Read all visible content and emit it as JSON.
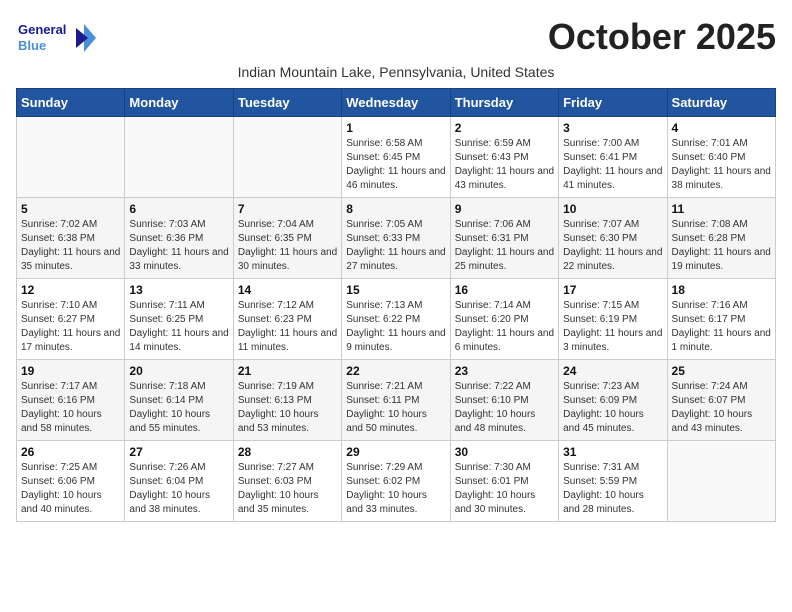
{
  "header": {
    "logo_line1": "General",
    "logo_line2": "Blue",
    "month": "October 2025",
    "subtitle": "Indian Mountain Lake, Pennsylvania, United States"
  },
  "days_of_week": [
    "Sunday",
    "Monday",
    "Tuesday",
    "Wednesday",
    "Thursday",
    "Friday",
    "Saturday"
  ],
  "weeks": [
    [
      {
        "day": "",
        "info": ""
      },
      {
        "day": "",
        "info": ""
      },
      {
        "day": "",
        "info": ""
      },
      {
        "day": "1",
        "info": "Sunrise: 6:58 AM\nSunset: 6:45 PM\nDaylight: 11 hours and 46 minutes."
      },
      {
        "day": "2",
        "info": "Sunrise: 6:59 AM\nSunset: 6:43 PM\nDaylight: 11 hours and 43 minutes."
      },
      {
        "day": "3",
        "info": "Sunrise: 7:00 AM\nSunset: 6:41 PM\nDaylight: 11 hours and 41 minutes."
      },
      {
        "day": "4",
        "info": "Sunrise: 7:01 AM\nSunset: 6:40 PM\nDaylight: 11 hours and 38 minutes."
      }
    ],
    [
      {
        "day": "5",
        "info": "Sunrise: 7:02 AM\nSunset: 6:38 PM\nDaylight: 11 hours and 35 minutes."
      },
      {
        "day": "6",
        "info": "Sunrise: 7:03 AM\nSunset: 6:36 PM\nDaylight: 11 hours and 33 minutes."
      },
      {
        "day": "7",
        "info": "Sunrise: 7:04 AM\nSunset: 6:35 PM\nDaylight: 11 hours and 30 minutes."
      },
      {
        "day": "8",
        "info": "Sunrise: 7:05 AM\nSunset: 6:33 PM\nDaylight: 11 hours and 27 minutes."
      },
      {
        "day": "9",
        "info": "Sunrise: 7:06 AM\nSunset: 6:31 PM\nDaylight: 11 hours and 25 minutes."
      },
      {
        "day": "10",
        "info": "Sunrise: 7:07 AM\nSunset: 6:30 PM\nDaylight: 11 hours and 22 minutes."
      },
      {
        "day": "11",
        "info": "Sunrise: 7:08 AM\nSunset: 6:28 PM\nDaylight: 11 hours and 19 minutes."
      }
    ],
    [
      {
        "day": "12",
        "info": "Sunrise: 7:10 AM\nSunset: 6:27 PM\nDaylight: 11 hours and 17 minutes."
      },
      {
        "day": "13",
        "info": "Sunrise: 7:11 AM\nSunset: 6:25 PM\nDaylight: 11 hours and 14 minutes."
      },
      {
        "day": "14",
        "info": "Sunrise: 7:12 AM\nSunset: 6:23 PM\nDaylight: 11 hours and 11 minutes."
      },
      {
        "day": "15",
        "info": "Sunrise: 7:13 AM\nSunset: 6:22 PM\nDaylight: 11 hours and 9 minutes."
      },
      {
        "day": "16",
        "info": "Sunrise: 7:14 AM\nSunset: 6:20 PM\nDaylight: 11 hours and 6 minutes."
      },
      {
        "day": "17",
        "info": "Sunrise: 7:15 AM\nSunset: 6:19 PM\nDaylight: 11 hours and 3 minutes."
      },
      {
        "day": "18",
        "info": "Sunrise: 7:16 AM\nSunset: 6:17 PM\nDaylight: 11 hours and 1 minute."
      }
    ],
    [
      {
        "day": "19",
        "info": "Sunrise: 7:17 AM\nSunset: 6:16 PM\nDaylight: 10 hours and 58 minutes."
      },
      {
        "day": "20",
        "info": "Sunrise: 7:18 AM\nSunset: 6:14 PM\nDaylight: 10 hours and 55 minutes."
      },
      {
        "day": "21",
        "info": "Sunrise: 7:19 AM\nSunset: 6:13 PM\nDaylight: 10 hours and 53 minutes."
      },
      {
        "day": "22",
        "info": "Sunrise: 7:21 AM\nSunset: 6:11 PM\nDaylight: 10 hours and 50 minutes."
      },
      {
        "day": "23",
        "info": "Sunrise: 7:22 AM\nSunset: 6:10 PM\nDaylight: 10 hours and 48 minutes."
      },
      {
        "day": "24",
        "info": "Sunrise: 7:23 AM\nSunset: 6:09 PM\nDaylight: 10 hours and 45 minutes."
      },
      {
        "day": "25",
        "info": "Sunrise: 7:24 AM\nSunset: 6:07 PM\nDaylight: 10 hours and 43 minutes."
      }
    ],
    [
      {
        "day": "26",
        "info": "Sunrise: 7:25 AM\nSunset: 6:06 PM\nDaylight: 10 hours and 40 minutes."
      },
      {
        "day": "27",
        "info": "Sunrise: 7:26 AM\nSunset: 6:04 PM\nDaylight: 10 hours and 38 minutes."
      },
      {
        "day": "28",
        "info": "Sunrise: 7:27 AM\nSunset: 6:03 PM\nDaylight: 10 hours and 35 minutes."
      },
      {
        "day": "29",
        "info": "Sunrise: 7:29 AM\nSunset: 6:02 PM\nDaylight: 10 hours and 33 minutes."
      },
      {
        "day": "30",
        "info": "Sunrise: 7:30 AM\nSunset: 6:01 PM\nDaylight: 10 hours and 30 minutes."
      },
      {
        "day": "31",
        "info": "Sunrise: 7:31 AM\nSunset: 5:59 PM\nDaylight: 10 hours and 28 minutes."
      },
      {
        "day": "",
        "info": ""
      }
    ]
  ]
}
